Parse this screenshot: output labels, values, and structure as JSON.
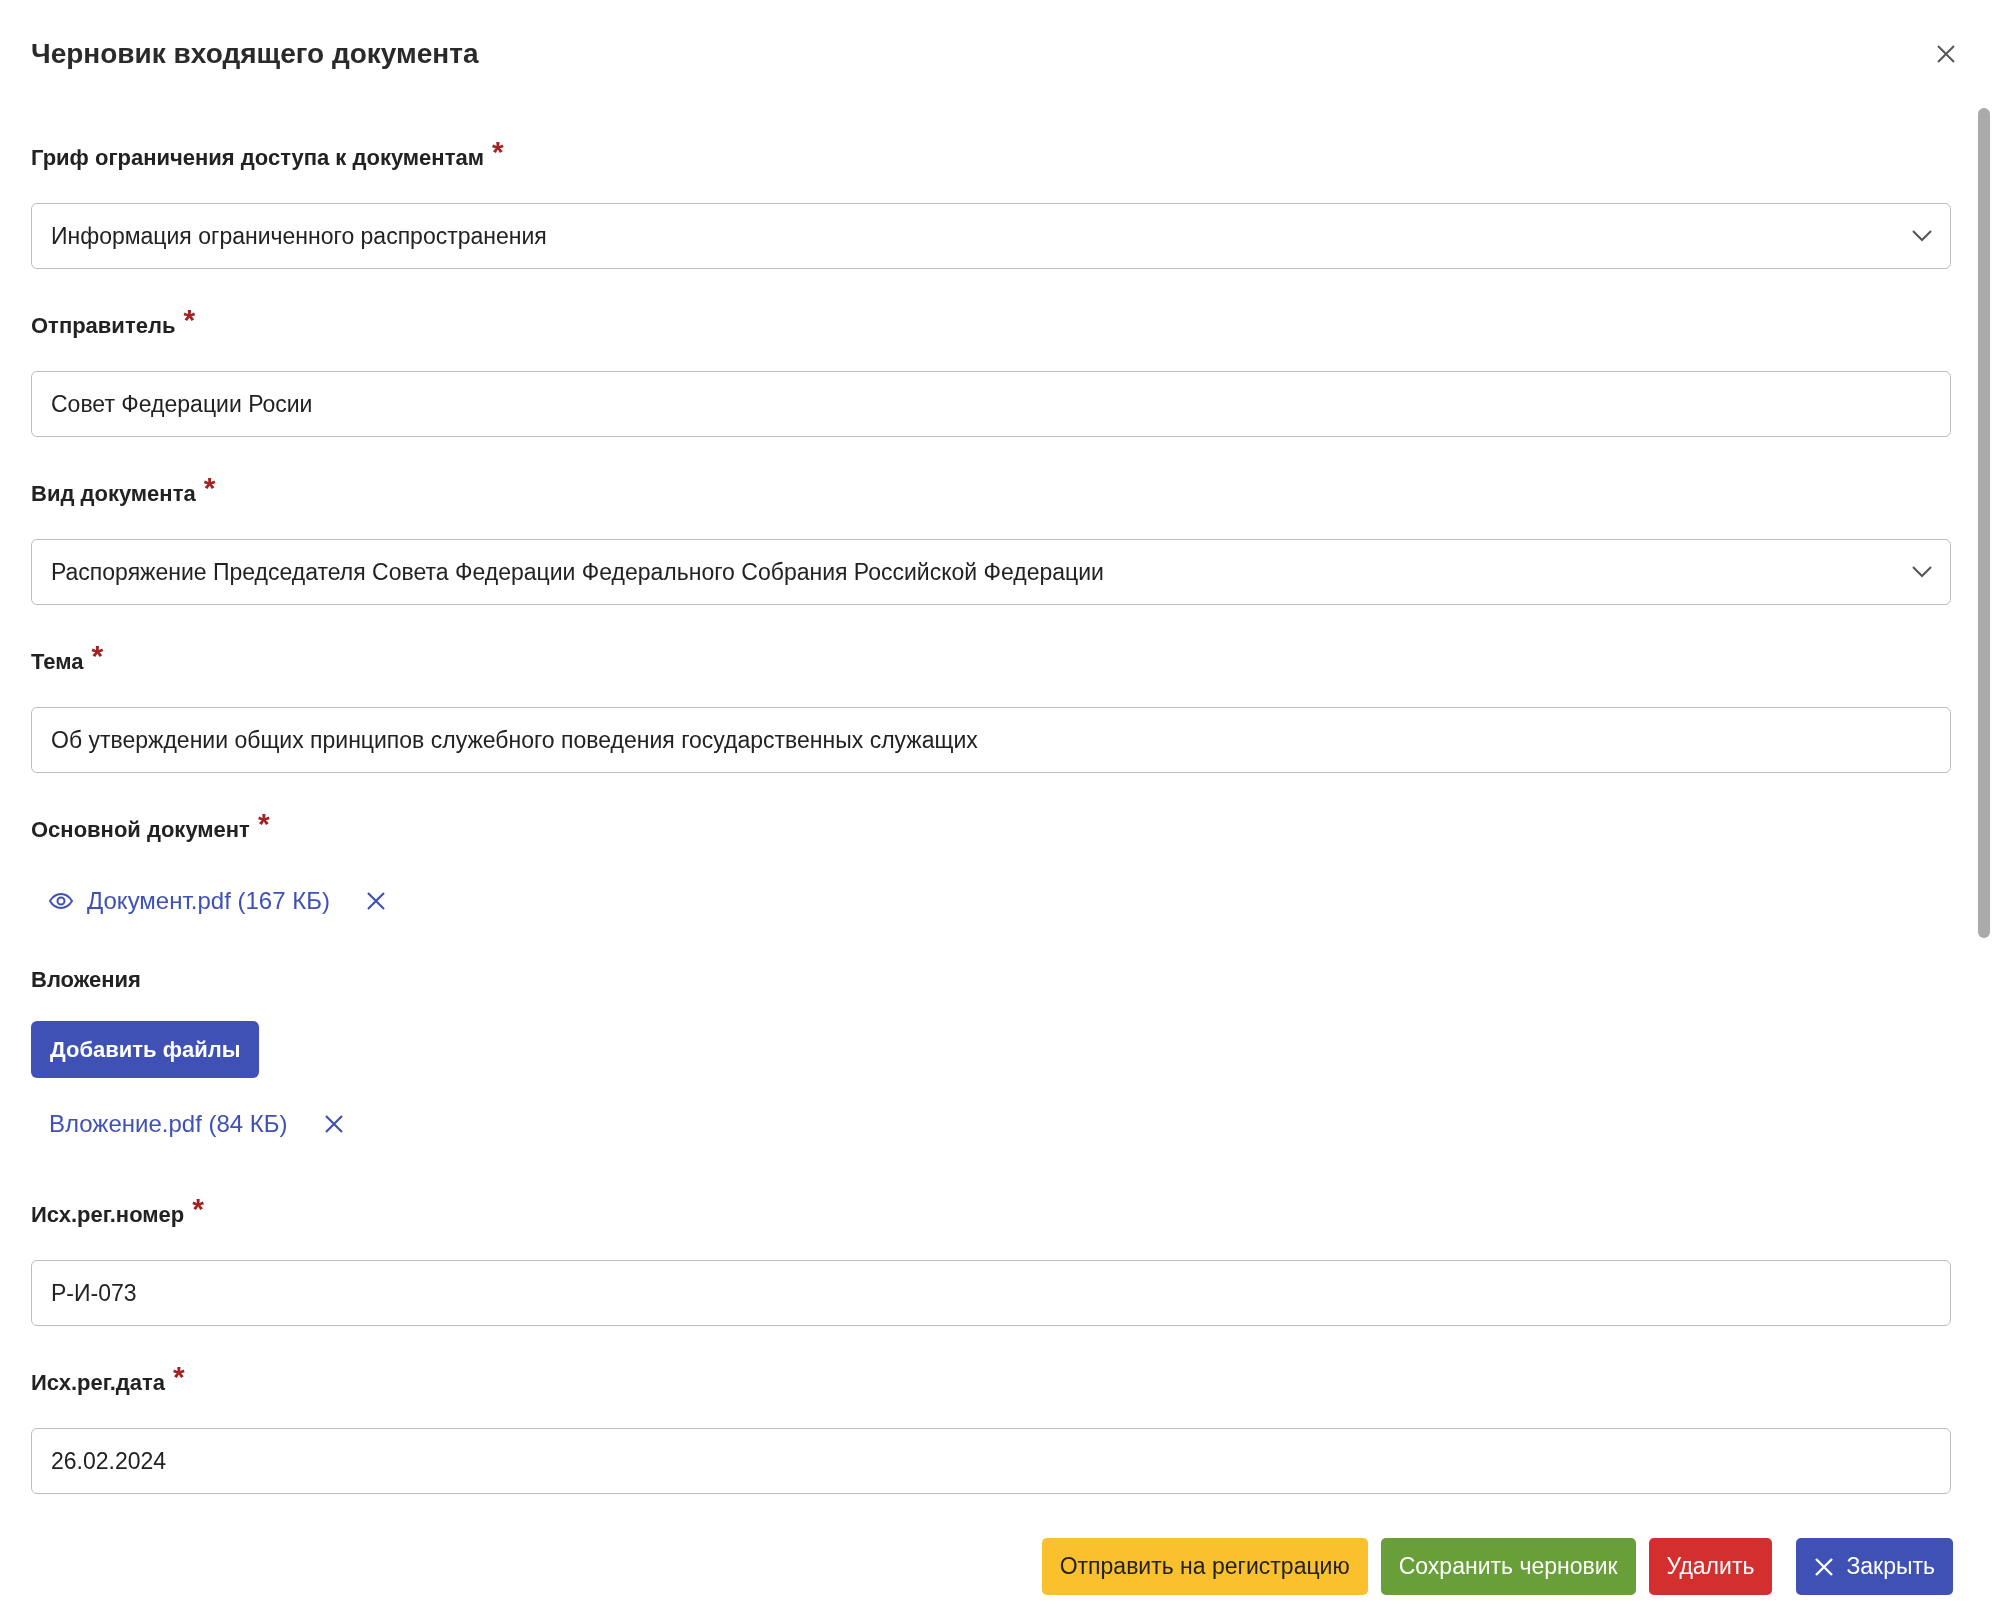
{
  "dialog": {
    "title": "Черновик входящего документа"
  },
  "fields": [
    {
      "kind": "select",
      "label": "Гриф ограничения доступа к документам",
      "mark": "*",
      "value": "Информация ограниченного распространения"
    },
    {
      "kind": "text",
      "label": "Отправитель",
      "mark": "*",
      "value": "Совет Федерации Росии"
    },
    {
      "kind": "select",
      "label": "Вид документа",
      "mark": "*",
      "value": "Распоряжение Председателя Совета Федерации Федерального Собрания Российской Федерации"
    },
    {
      "kind": "text",
      "label": "Тема",
      "mark": "*",
      "value": "Об утверждении общих принципов служебного поведения государственных служащих"
    },
    {
      "kind": "files",
      "label": "Основной документ",
      "mark": "*",
      "files": [
        {
          "name": "Документ.pdf (167 КБ)",
          "preview": true
        }
      ]
    },
    {
      "kind": "attachments",
      "label": "Вложения",
      "button": "Добавить файлы",
      "files": [
        {
          "name": "Вложение.pdf (84 КБ)",
          "preview": false
        }
      ]
    },
    {
      "kind": "text",
      "label": "Исх.рег.номер",
      "mark": "*",
      "value": "Р-И-073"
    },
    {
      "kind": "text",
      "label": "Исх.рег.дата",
      "mark": "*",
      "value": "26.02.2024"
    }
  ],
  "buttons": [
    {
      "label": "Отправить на регистрацию",
      "kind": "warning"
    },
    {
      "label": "Сохранить черновик",
      "kind": "success"
    },
    {
      "label": "Удалить",
      "kind": "danger"
    },
    {
      "label": "Закрыть",
      "kind": "primary"
    }
  ]
}
